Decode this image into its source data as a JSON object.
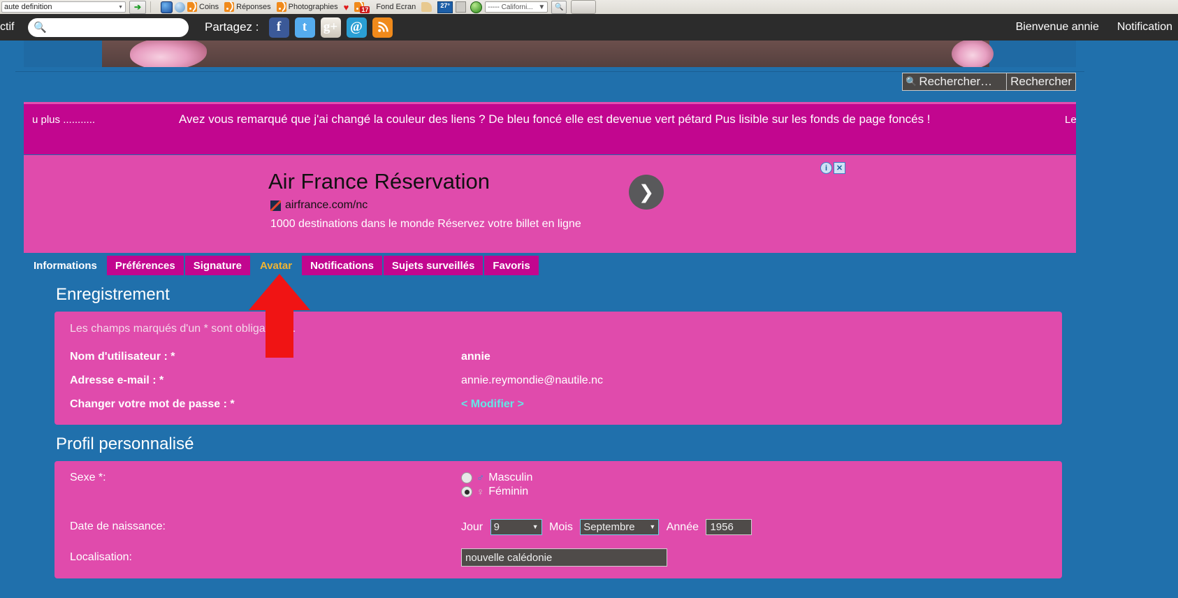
{
  "browser": {
    "address_value": "aute definition",
    "go_icon": "go-arrow-icon",
    "bookmarks": [
      {
        "label": "Coins",
        "icon": "rss-icon"
      },
      {
        "label": "Réponses",
        "icon": "rss-icon"
      },
      {
        "label": "Photographies",
        "icon": "rss-icon"
      },
      {
        "label": "Fond Ecran",
        "icon": "rss-icon",
        "badge": "17"
      }
    ],
    "weather_badge": "27°",
    "region_select": "----- Californi...",
    "heart_icon": "heart-icon",
    "magnifier_icon": "magnifier-icon"
  },
  "topbar": {
    "left_label": "ctif",
    "search_placeholder": "",
    "search_value": "",
    "search_icon": "search-icon",
    "share_label": "Partagez :",
    "social": [
      {
        "name": "facebook-icon",
        "glyph": "f"
      },
      {
        "name": "twitter-icon",
        "glyph": "t"
      },
      {
        "name": "google-plus-icon",
        "glyph": "g+"
      },
      {
        "name": "email-icon",
        "glyph": "@"
      },
      {
        "name": "rss-icon",
        "glyph": ""
      }
    ],
    "welcome": "Bienvenue annie",
    "notifications": "Notification"
  },
  "site_search": {
    "field_text": "Rechercher…",
    "button_label": "Rechercher",
    "magnifier_icon": "magnifier-icon"
  },
  "announcement": {
    "left": "u plus ...........",
    "middle": "Avez vous remarqué que j'ai changé la couleur des liens ? De bleu foncé elle est devenue vert pétard Pus lisible sur les fonds de page foncés !",
    "right": "Le"
  },
  "ad": {
    "title": "Air France Réservation",
    "url": "airfrance.com/nc",
    "description": "1000 destinations dans le monde Réservez votre billet en ligne",
    "arrow_glyph": "❯",
    "info_glyph": "i",
    "close_glyph": "✕"
  },
  "tabs": [
    {
      "label": "Informations",
      "state": "active"
    },
    {
      "label": "Préférences",
      "state": "normal"
    },
    {
      "label": "Signature",
      "state": "normal"
    },
    {
      "label": "Avatar",
      "state": "highlighted"
    },
    {
      "label": "Notifications",
      "state": "normal"
    },
    {
      "label": "Sujets surveillés",
      "state": "normal"
    },
    {
      "label": "Favoris",
      "state": "normal"
    }
  ],
  "registration": {
    "heading": "Enregistrement",
    "note": "Les champs marqués d'un * sont obligatoires.",
    "rows": [
      {
        "label": "Nom d'utilisateur : *",
        "value": "annie",
        "bold": true
      },
      {
        "label": "Adresse e-mail : *",
        "value": "annie.reymondie@nautile.nc",
        "bold": false
      },
      {
        "label": "Changer votre mot de passe : *",
        "value": "< Modifier >",
        "link": true
      }
    ]
  },
  "profile": {
    "heading": "Profil personnalisé",
    "sex_label": "Sexe *:",
    "sex_options": [
      {
        "label": "Masculin",
        "symbol": "♂",
        "selected": false
      },
      {
        "label": "Féminin",
        "symbol": "♀",
        "selected": true
      }
    ],
    "birth_label": "Date de naissance:",
    "day_label": "Jour",
    "day_value": "9",
    "month_label": "Mois",
    "month_value": "Septembre",
    "year_label": "Année",
    "year_value": "1956",
    "location_label": "Localisation:",
    "location_value": "nouvelle calédonie"
  },
  "colors": {
    "site_blue": "#2070ac",
    "magenta": "#c2068f",
    "pink": "#e04bac",
    "tab_highlight": "#f2b431",
    "link_cyan": "#63e6e6",
    "annotation_red": "#f01414"
  }
}
